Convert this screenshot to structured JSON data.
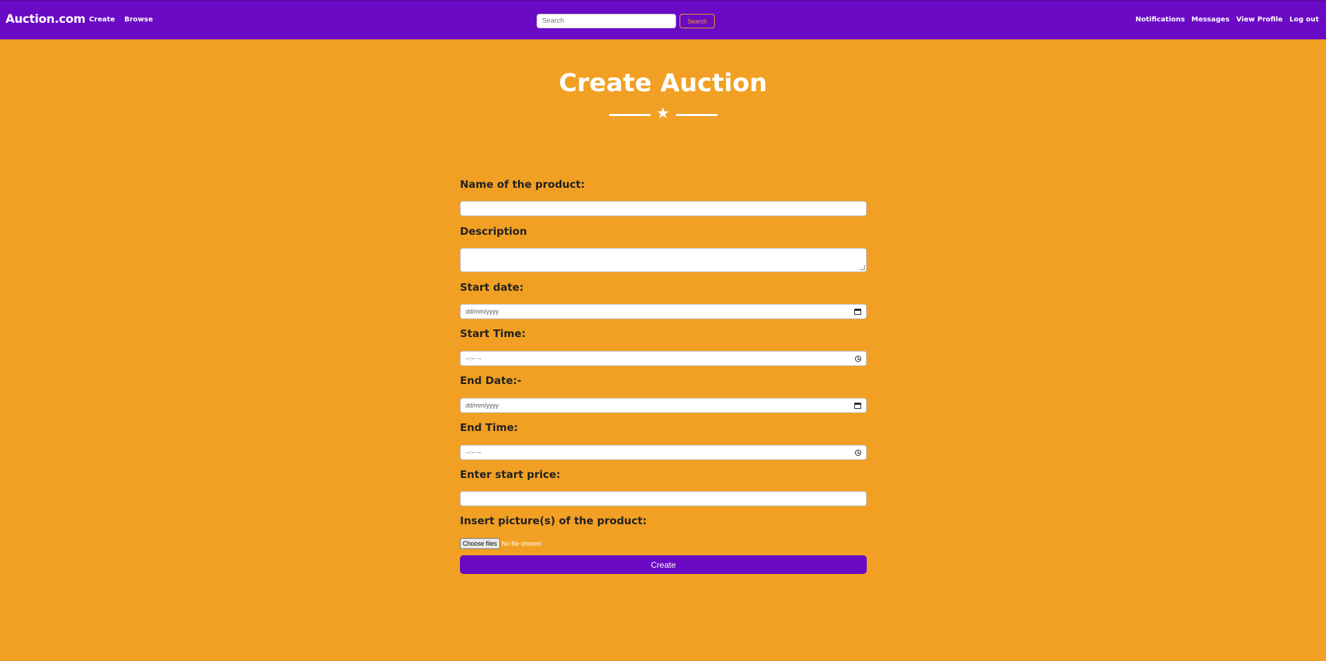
{
  "navbar": {
    "brand": "Auction.com",
    "links_left": [
      "Create",
      "Browse"
    ],
    "search": {
      "placeholder": "Search",
      "button_label": "Search"
    },
    "links_right": [
      "Notifications",
      "Messages",
      "View Profile",
      "Log out"
    ]
  },
  "header": {
    "title": "Create Auction",
    "divider_icon": "star-icon"
  },
  "form": {
    "name_label": "Name of the product:",
    "description_label": "Description",
    "start_date_label": "Start date:",
    "start_date_placeholder": "dd/mm/yyyy",
    "start_time_label": "Start Time:",
    "start_time_placeholder": "--:-- --",
    "end_date_label": "End Date:-",
    "end_date_placeholder": "dd/mm/yyyy",
    "end_time_label": "End Time:",
    "end_time_placeholder": "--:-- --",
    "start_price_label": "Enter start price:",
    "picture_label": "Insert picture(s) of the product:",
    "choose_files_label": "Choose files",
    "no_file_text": "No file chosen",
    "submit_label": "Create"
  },
  "colors": {
    "navbar": "#6a0ac4",
    "background": "#f2a023",
    "accent": "#f2a023"
  }
}
